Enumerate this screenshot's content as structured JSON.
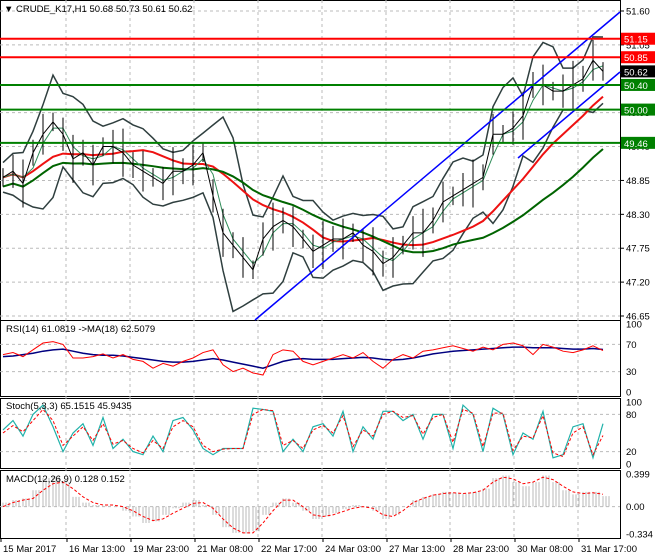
{
  "header": {
    "symbol": "CRUDE_K17,H1",
    "ohlc": "50.68 50.73 50.61 50.62"
  },
  "chart_data": {
    "type": "line",
    "title": "CRUDE_K17,H1",
    "price_axis": {
      "ylim": [
        46.65,
        51.6
      ],
      "ticks": [
        "51.60",
        "51.05",
        "49.95",
        "49.40",
        "48.85",
        "48.30",
        "47.75",
        "47.20",
        "46.65"
      ]
    },
    "x_ticks": [
      "15 Mar 2017",
      "16 Mar 13:00",
      "19 Mar 23:00",
      "21 Mar 08:00",
      "22 Mar 17:00",
      "24 Mar 03:00",
      "27 Mar 13:00",
      "28 Mar 23:00",
      "30 Mar 08:00",
      "31 Mar 17:00"
    ],
    "close": [
      48.9,
      49.0,
      48.8,
      49.3,
      49.6,
      49.8,
      49.6,
      49.2,
      49.3,
      49.1,
      49.4,
      49.4,
      49.3,
      49.1,
      49.0,
      48.9,
      48.8,
      49.0,
      49.0,
      49.1,
      49.3,
      48.6,
      48.0,
      47.8,
      47.6,
      47.4,
      47.9,
      48.1,
      48.2,
      48.1,
      47.9,
      47.7,
      47.8,
      47.9,
      47.9,
      48.0,
      47.8,
      47.7,
      47.5,
      47.6,
      47.8,
      48.0,
      48.0,
      48.2,
      48.5,
      48.6,
      48.7,
      48.8,
      48.9,
      49.6,
      49.6,
      49.7,
      49.9,
      50.4,
      50.4,
      50.3,
      50.3,
      50.4,
      50.5,
      50.8,
      50.62
    ],
    "levels": [
      {
        "value": "51.15",
        "color": "#ff0000"
      },
      {
        "value": "50.85",
        "color": "#ff0000"
      },
      {
        "value": "50.62",
        "color": "#000000"
      },
      {
        "value": "50.40",
        "color": "#008000"
      },
      {
        "value": "50.00",
        "color": "#008000"
      },
      {
        "value": "49.46",
        "color": "#008000"
      }
    ],
    "rsi": {
      "label": "RSI(14) 61.0819  ->MA(18) 62.5079",
      "ylim": [
        0,
        100
      ],
      "ticks": [
        "100",
        "70",
        "30",
        "0"
      ],
      "values": [
        55,
        58,
        52,
        62,
        72,
        74,
        70,
        50,
        50,
        52,
        56,
        50,
        55,
        48,
        45,
        35,
        42,
        38,
        45,
        50,
        58,
        62,
        40,
        30,
        35,
        28,
        25,
        55,
        62,
        60,
        45,
        40,
        45,
        50,
        55,
        50,
        58,
        45,
        35,
        48,
        55,
        50,
        60,
        62,
        65,
        68,
        64,
        60,
        66,
        62,
        70,
        72,
        68,
        55,
        70,
        66,
        60,
        58,
        62,
        68,
        61
      ],
      "ma": [
        52,
        53,
        55,
        57,
        60,
        62,
        63,
        60,
        57,
        55,
        54,
        54,
        53,
        51,
        49,
        47,
        45,
        44,
        44,
        45,
        47,
        49,
        47,
        44,
        41,
        38,
        35,
        40,
        45,
        48,
        49,
        48,
        48,
        48,
        49,
        50,
        51,
        50,
        48,
        47,
        48,
        50,
        53,
        56,
        58,
        60,
        61,
        62,
        63,
        64,
        65,
        66,
        66,
        65,
        65,
        65,
        64,
        63,
        63,
        64,
        62.5
      ]
    },
    "stoch": {
      "label": "Stoch(5,3,3) 65.1515 45.9435",
      "ylim": [
        0,
        100
      ],
      "ticks": [
        "100",
        "80",
        "20",
        "0"
      ],
      "k": [
        55,
        70,
        45,
        80,
        95,
        60,
        20,
        50,
        65,
        30,
        75,
        25,
        40,
        20,
        15,
        45,
        20,
        70,
        75,
        55,
        25,
        15,
        25,
        25,
        25,
        90,
        88,
        85,
        20,
        40,
        20,
        60,
        65,
        45,
        85,
        20,
        60,
        40,
        85,
        85,
        70,
        80,
        40,
        80,
        80,
        25,
        95,
        80,
        20,
        90,
        80,
        15,
        50,
        40,
        85,
        10,
        15,
        60,
        65,
        10,
        65
      ],
      "d": [
        50,
        62,
        52,
        70,
        88,
        70,
        30,
        45,
        60,
        38,
        65,
        32,
        38,
        25,
        18,
        38,
        25,
        60,
        70,
        60,
        30,
        20,
        24,
        25,
        25,
        80,
        88,
        86,
        30,
        38,
        25,
        55,
        62,
        50,
        78,
        28,
        55,
        45,
        80,
        85,
        75,
        78,
        48,
        75,
        80,
        35,
        88,
        82,
        28,
        82,
        82,
        22,
        45,
        42,
        78,
        18,
        12,
        50,
        60,
        15,
        46
      ]
    },
    "macd": {
      "label": "MACD(12,26,9) 0.128 0.152",
      "ylim": [
        -0.334,
        0.399
      ],
      "ticks": [
        "0.399",
        "0.00",
        "-0.334"
      ],
      "hist": [
        0.05,
        0.08,
        0.1,
        0.2,
        0.35,
        0.37,
        0.3,
        0.12,
        0.05,
        0.02,
        0.01,
        0.0,
        -0.05,
        -0.12,
        -0.2,
        -0.18,
        -0.1,
        -0.02,
        0.05,
        0.08,
        0.02,
        -0.1,
        -0.25,
        -0.32,
        -0.33,
        -0.3,
        -0.1,
        0.05,
        0.1,
        0.05,
        -0.05,
        -0.15,
        -0.12,
        -0.08,
        -0.03,
        0.02,
        0.0,
        -0.05,
        -0.15,
        -0.1,
        0.0,
        0.08,
        0.12,
        0.15,
        0.18,
        0.17,
        0.16,
        0.18,
        0.22,
        0.35,
        0.38,
        0.3,
        0.25,
        0.3,
        0.38,
        0.3,
        0.2,
        0.15,
        0.18,
        0.18,
        0.128
      ],
      "signal": [
        0.0,
        0.05,
        0.08,
        0.1,
        0.2,
        0.28,
        0.3,
        0.22,
        0.12,
        0.05,
        0.02,
        0.02,
        0.0,
        -0.05,
        -0.12,
        -0.17,
        -0.15,
        -0.08,
        -0.02,
        0.04,
        0.05,
        -0.02,
        -0.15,
        -0.26,
        -0.32,
        -0.32,
        -0.2,
        -0.05,
        0.08,
        0.08,
        0.0,
        -0.1,
        -0.12,
        -0.1,
        -0.06,
        -0.02,
        0.0,
        -0.02,
        -0.1,
        -0.12,
        -0.05,
        0.05,
        0.1,
        0.14,
        0.16,
        0.17,
        0.16,
        0.17,
        0.2,
        0.3,
        0.36,
        0.34,
        0.28,
        0.3,
        0.36,
        0.33,
        0.25,
        0.18,
        0.16,
        0.17,
        0.152
      ]
    }
  }
}
